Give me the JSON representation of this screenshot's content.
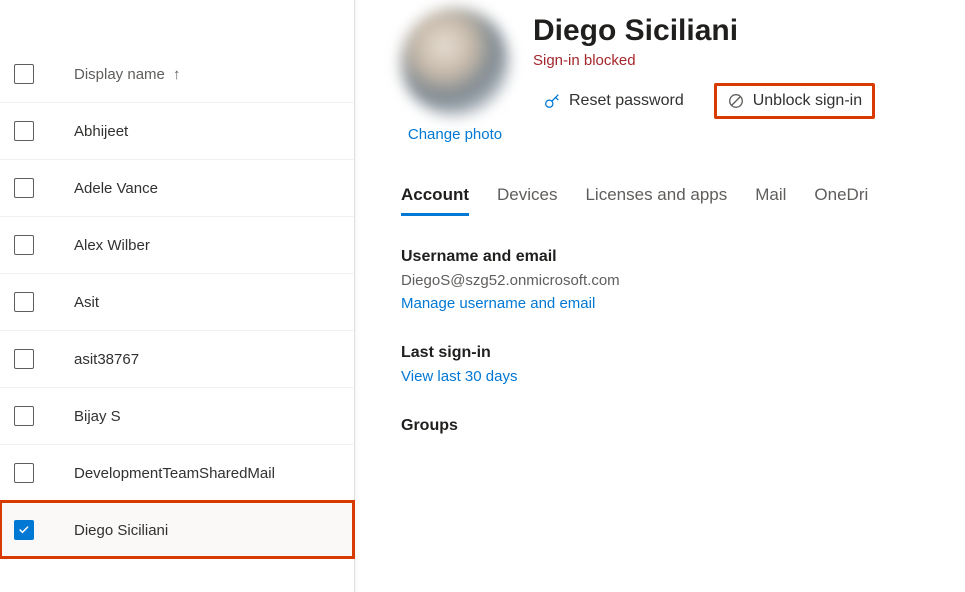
{
  "list": {
    "column_header": "Display name",
    "sort_indicator": "↑",
    "rows": [
      {
        "name": "Abhijeet",
        "selected": false
      },
      {
        "name": "Adele Vance",
        "selected": false
      },
      {
        "name": "Alex Wilber",
        "selected": false
      },
      {
        "name": "Asit",
        "selected": false
      },
      {
        "name": "asit38767",
        "selected": false
      },
      {
        "name": "Bijay S",
        "selected": false
      },
      {
        "name": "DevelopmentTeamSharedMail",
        "selected": false
      },
      {
        "name": "Diego Siciliani",
        "selected": true
      }
    ]
  },
  "detail": {
    "change_photo": "Change photo",
    "display_name": "Diego Siciliani",
    "status": "Sign-in blocked",
    "actions": {
      "reset_password": "Reset password",
      "unblock_signin": "Unblock sign-in"
    },
    "tabs": {
      "account": "Account",
      "devices": "Devices",
      "licenses": "Licenses and apps",
      "mail": "Mail",
      "onedrive": "OneDri"
    },
    "username_section": {
      "label": "Username and email",
      "value": "DiegoS@szg52.onmicrosoft.com",
      "manage_link": "Manage username and email"
    },
    "signin_section": {
      "label": "Last sign-in",
      "link": "View last 30 days"
    },
    "groups_section": {
      "label": "Groups"
    }
  }
}
